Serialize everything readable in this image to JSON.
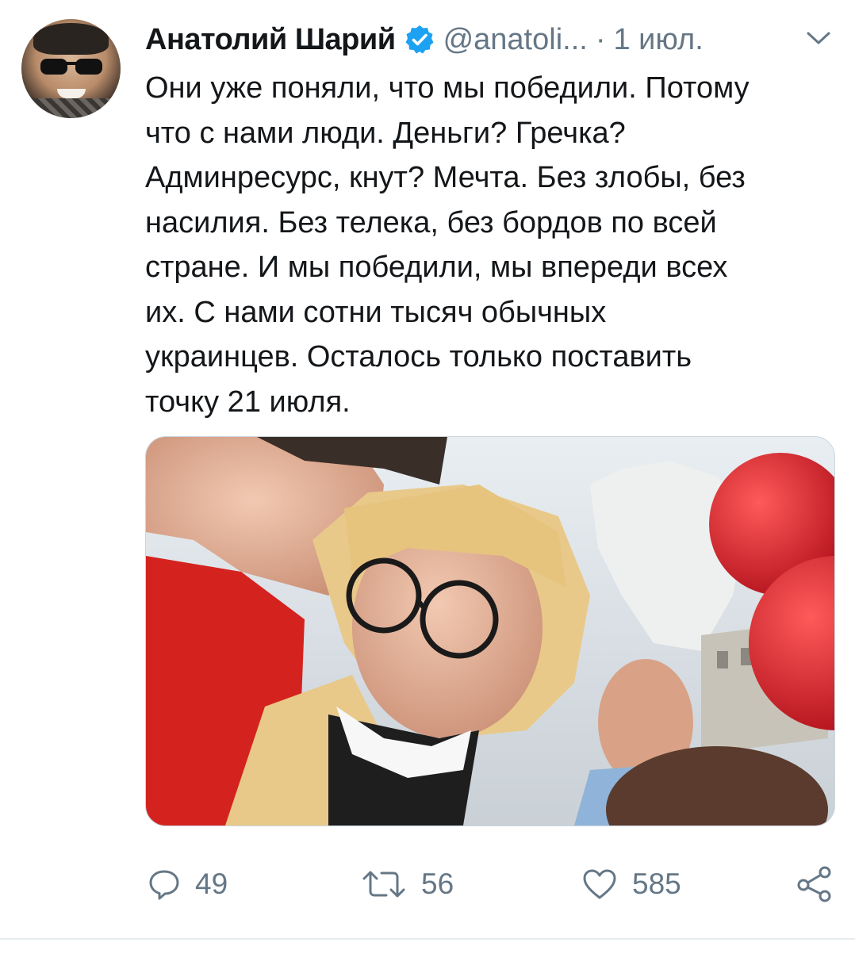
{
  "tweet": {
    "author_name": "Анатолий Шарий",
    "handle": "@anatoli...",
    "separator": "·",
    "date": "1 июл.",
    "text_lines": [
      "Они уже поняли, что мы победили. Потому",
      "что с нами люди. Деньги? Гречка?",
      "Админресурс, кнут? Мечта. Без злобы, без",
      "насилия. Без телека, без бордов по всей",
      "стране. И мы победили, мы впереди всех",
      "их. С нами сотни тысяч обычных",
      "украинцев. Осталось только поставить",
      "точку 21 июля."
    ],
    "verified": true,
    "icons": {
      "verified": "verified-badge-icon",
      "menu": "chevron-down-icon",
      "reply": "reply-icon",
      "retweet": "retweet-icon",
      "like": "heart-icon",
      "share": "share-icon"
    }
  },
  "actions": {
    "replies": "49",
    "retweets": "56",
    "likes": "585"
  },
  "colors": {
    "text_primary": "#14171a",
    "text_secondary": "#657786",
    "verified_blue": "#1da1f2",
    "divider": "#e6ecf0"
  }
}
